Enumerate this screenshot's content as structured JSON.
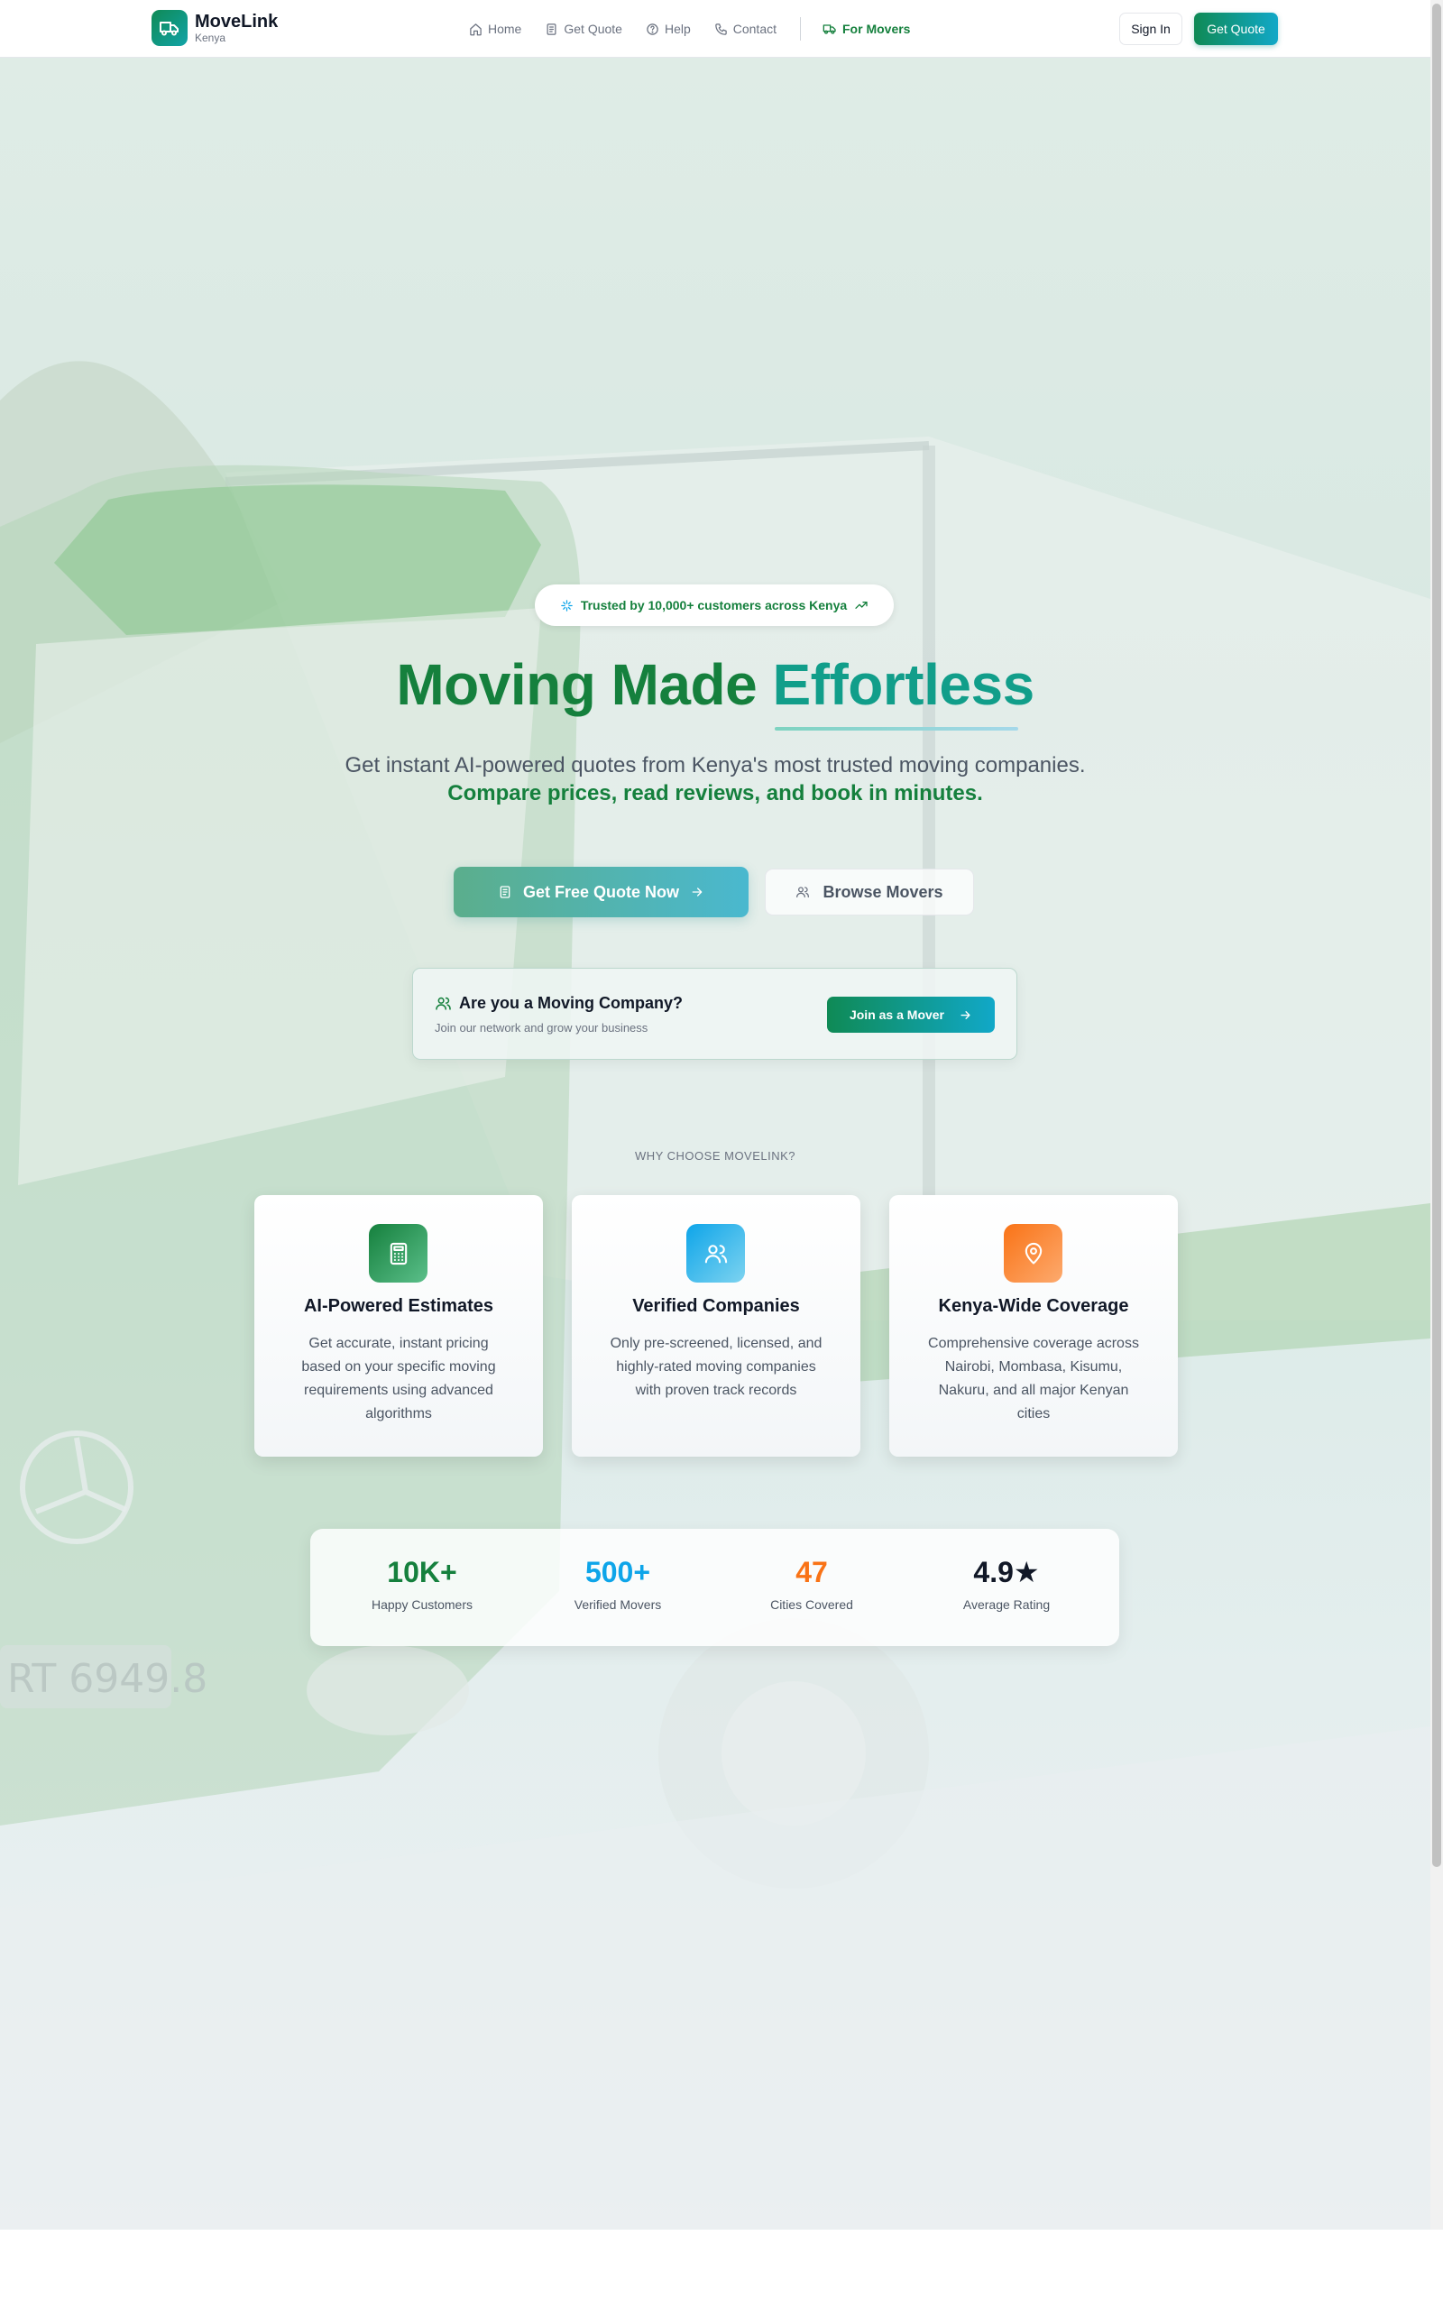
{
  "header": {
    "logo_name": "MoveLink",
    "logo_sub": "Kenya",
    "nav": [
      {
        "label": "Home",
        "icon": "home-icon"
      },
      {
        "label": "Get Quote",
        "icon": "document-icon"
      },
      {
        "label": "Help",
        "icon": "help-circle-icon"
      },
      {
        "label": "Contact",
        "icon": "phone-icon"
      },
      {
        "label": "For Movers",
        "icon": "truck-icon"
      }
    ],
    "sign_in": "Sign In",
    "get_quote": "Get Quote"
  },
  "hero": {
    "badge": "Trusted by 10,000+ customers across Kenya",
    "title_part1": "Moving Made ",
    "title_part2": "Effortless",
    "subtitle_line1": "Get instant AI-powered quotes from Kenya's most trusted moving companies.",
    "subtitle_line2": "Compare prices, read reviews, and book in minutes.",
    "primary_cta": "Get Free Quote Now",
    "secondary_cta": "Browse Movers"
  },
  "mover_card": {
    "title": "Are you a Moving Company?",
    "subtitle": "Join our network and grow your business",
    "cta": "Join as a Mover"
  },
  "why": {
    "heading": "WHY CHOOSE MOVELINK?",
    "features": [
      {
        "title": "AI-Powered Estimates",
        "description": "Get accurate, instant pricing based on your specific moving requirements using advanced algorithms",
        "icon": "calculator-icon",
        "color": "#15803d"
      },
      {
        "title": "Verified Companies",
        "description": "Only pre-screened, licensed, and highly-rated moving companies with proven track records",
        "icon": "users-icon",
        "color": "#0ea5e9"
      },
      {
        "title": "Kenya-Wide Coverage",
        "description": "Comprehensive coverage across Nairobi, Mombasa, Kisumu, Nakuru, and all major Kenyan cities",
        "icon": "map-pin-icon",
        "color": "#f97316"
      }
    ]
  },
  "stats": [
    {
      "value": "10K+",
      "label": "Happy Customers",
      "color": "#15803d"
    },
    {
      "value": "500+",
      "label": "Verified Movers",
      "color": "#0ea5e9"
    },
    {
      "value": "47",
      "label": "Cities Covered",
      "color": "#f97316"
    },
    {
      "value": "4.9★",
      "label": "Average Rating",
      "color": "#111827"
    }
  ]
}
